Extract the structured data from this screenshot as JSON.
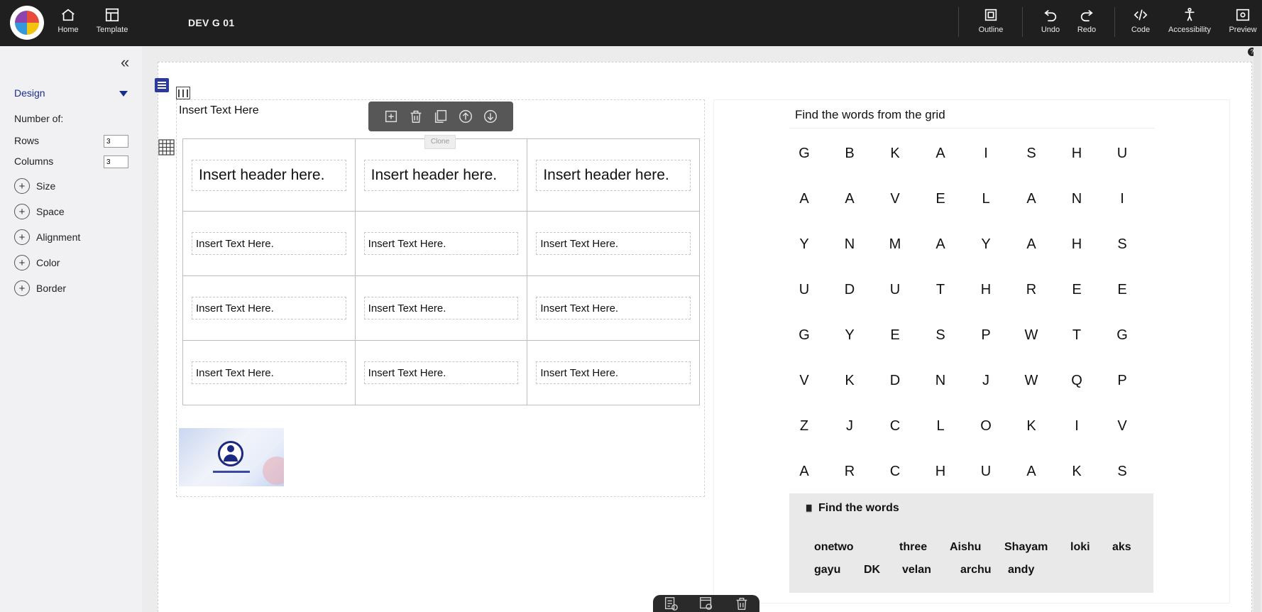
{
  "topbar": {
    "home_label": "Home",
    "template_label": "Template",
    "doc_title": "DEV G 01",
    "outline_label": "Outline",
    "undo_label": "Undo",
    "redo_label": "Redo",
    "code_label": "Code",
    "accessibility_label": "Accessibility",
    "preview_label": "Preview"
  },
  "sidebar": {
    "collapse_glyph": "«",
    "design_label": "Design",
    "number_of_label": "Number of:",
    "rows_label": "Rows",
    "rows_value": "3",
    "columns_label": "Columns",
    "columns_value": "3",
    "sections": [
      "Size",
      "Space",
      "Alignment",
      "Color",
      "Border"
    ]
  },
  "canvas": {
    "help_glyph": "?",
    "insert_text": "Insert Text Here",
    "tooltip": "Clone",
    "table": {
      "headers": [
        "Insert header here.",
        "Insert header here.",
        "Insert header here."
      ],
      "rows": [
        [
          "Insert Text Here.",
          "Insert Text Here.",
          "Insert Text Here."
        ],
        [
          "Insert Text Here.",
          "Insert Text Here.",
          "Insert Text Here."
        ],
        [
          "Insert Text Here.",
          "Insert Text Here.",
          "Insert Text Here."
        ]
      ]
    }
  },
  "word_search": {
    "title": "Find the words from the grid",
    "grid": [
      [
        "G",
        "B",
        "K",
        "A",
        "I",
        "S",
        "H",
        "U"
      ],
      [
        "A",
        "A",
        "V",
        "E",
        "L",
        "A",
        "N",
        "I"
      ],
      [
        "Y",
        "N",
        "M",
        "A",
        "Y",
        "A",
        "H",
        "S"
      ],
      [
        "U",
        "D",
        "U",
        "T",
        "H",
        "R",
        "E",
        "E"
      ],
      [
        "G",
        "Y",
        "E",
        "S",
        "P",
        "W",
        "T",
        "G"
      ],
      [
        "V",
        "K",
        "D",
        "N",
        "J",
        "W",
        "Q",
        "P"
      ],
      [
        "Z",
        "J",
        "C",
        "L",
        "O",
        "K",
        "I",
        "V"
      ],
      [
        "A",
        "R",
        "C",
        "H",
        "U",
        "A",
        "K",
        "S"
      ]
    ],
    "words_header": "Find the words",
    "words_row1": [
      "one",
      "two",
      "three",
      "Aishu",
      "Shayam",
      "loki",
      "aks"
    ],
    "words_row2": [
      "gayu",
      "DK",
      "velan",
      "archu",
      "andy"
    ]
  }
}
